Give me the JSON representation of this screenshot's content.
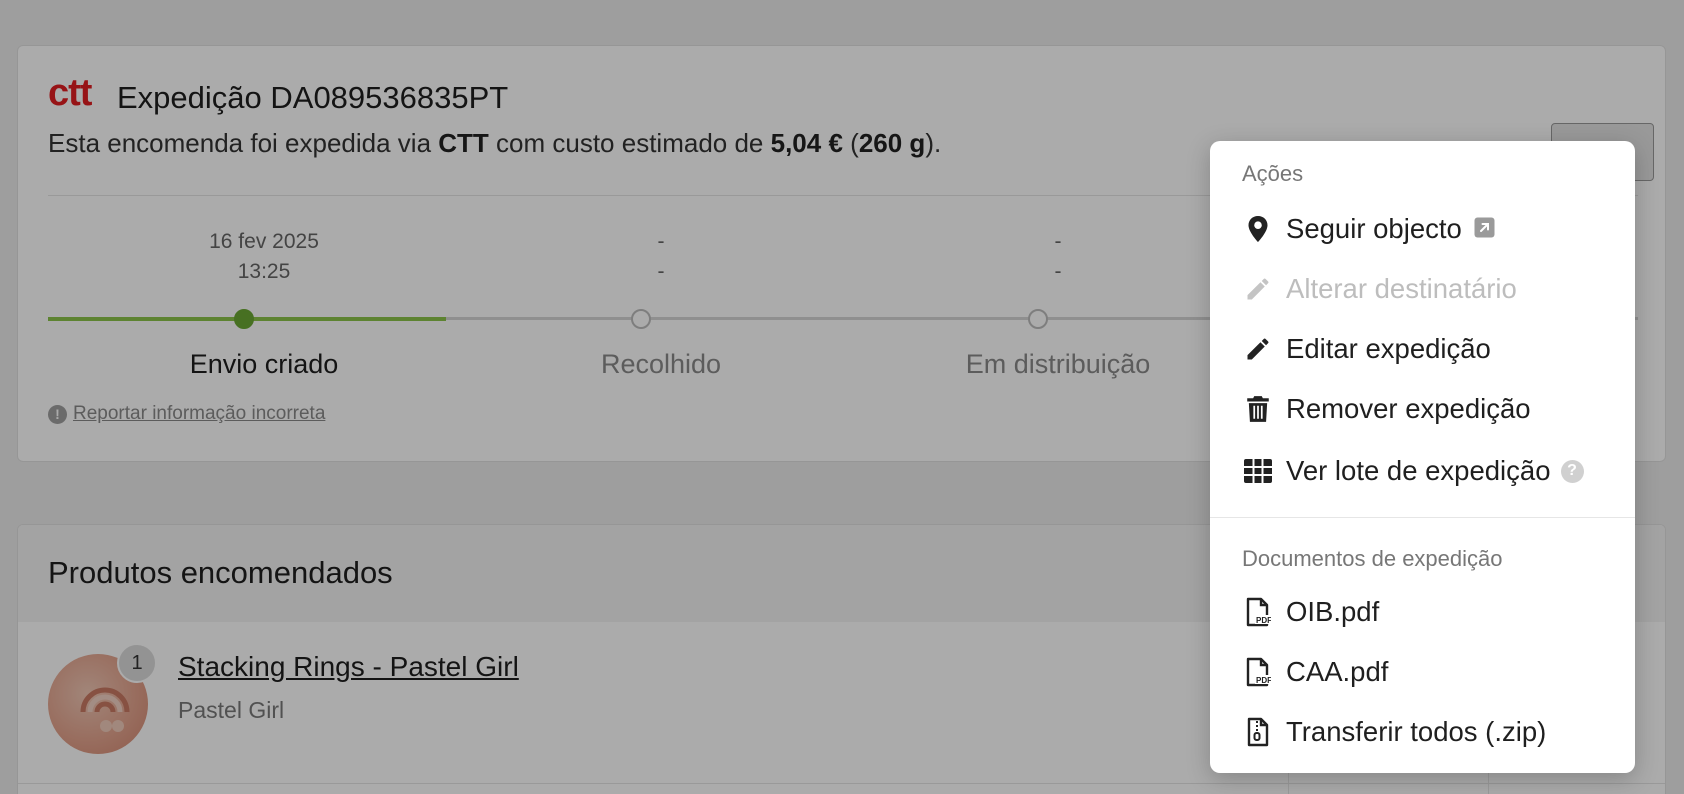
{
  "shipment": {
    "logo_text": "ctt",
    "title": "Expedição DA089536835PT",
    "desc_prefix": "Esta encomenda foi expedida via ",
    "carrier": "CTT",
    "desc_mid": " com custo estimado de ",
    "cost": "5,04 €",
    "weight_open": " (",
    "weight": "260 g",
    "weight_close": ")."
  },
  "tracking": {
    "progress_fraction": 0.25,
    "steps": [
      {
        "date": "16 fev 2025",
        "time": "13:25",
        "label": "Envio criado",
        "done": true
      },
      {
        "date": "-",
        "time": "-",
        "label": "Recolhido",
        "done": false
      },
      {
        "date": "-",
        "time": "-",
        "label": "Em distribuição",
        "done": false
      }
    ],
    "report_link": "Reportar informação incorreta"
  },
  "products": {
    "title": "Produtos encomendados",
    "items": [
      {
        "quantity": "1",
        "name": "Stacking Rings - Pastel Girl",
        "variant": "Pastel Girl"
      }
    ]
  },
  "menu": {
    "actions_heading": "Ações",
    "actions": [
      {
        "label": "Seguir objecto",
        "icon": "map-pin-icon",
        "disabled": false
      },
      {
        "label": "Alterar destinatário",
        "icon": "pencil-icon",
        "disabled": true
      },
      {
        "label": "Editar expedição",
        "icon": "pencil-icon",
        "disabled": false
      },
      {
        "label": "Remover expedição",
        "icon": "trash-icon",
        "disabled": false
      },
      {
        "label": "Ver lote de expedição",
        "icon": "table-icon",
        "disabled": false
      }
    ],
    "documents_heading": "Documentos de expedição",
    "documents": [
      {
        "label": "OIB.pdf",
        "icon": "pdf-file-icon"
      },
      {
        "label": "CAA.pdf",
        "icon": "pdf-file-icon"
      },
      {
        "label": "Transferir todos (.zip)",
        "icon": "zip-file-icon"
      }
    ],
    "help_glyph": "?"
  },
  "colors": {
    "brand": "#e11d21",
    "progress": "#6aa834",
    "overlay": "rgba(0,0,0,0.33)"
  }
}
